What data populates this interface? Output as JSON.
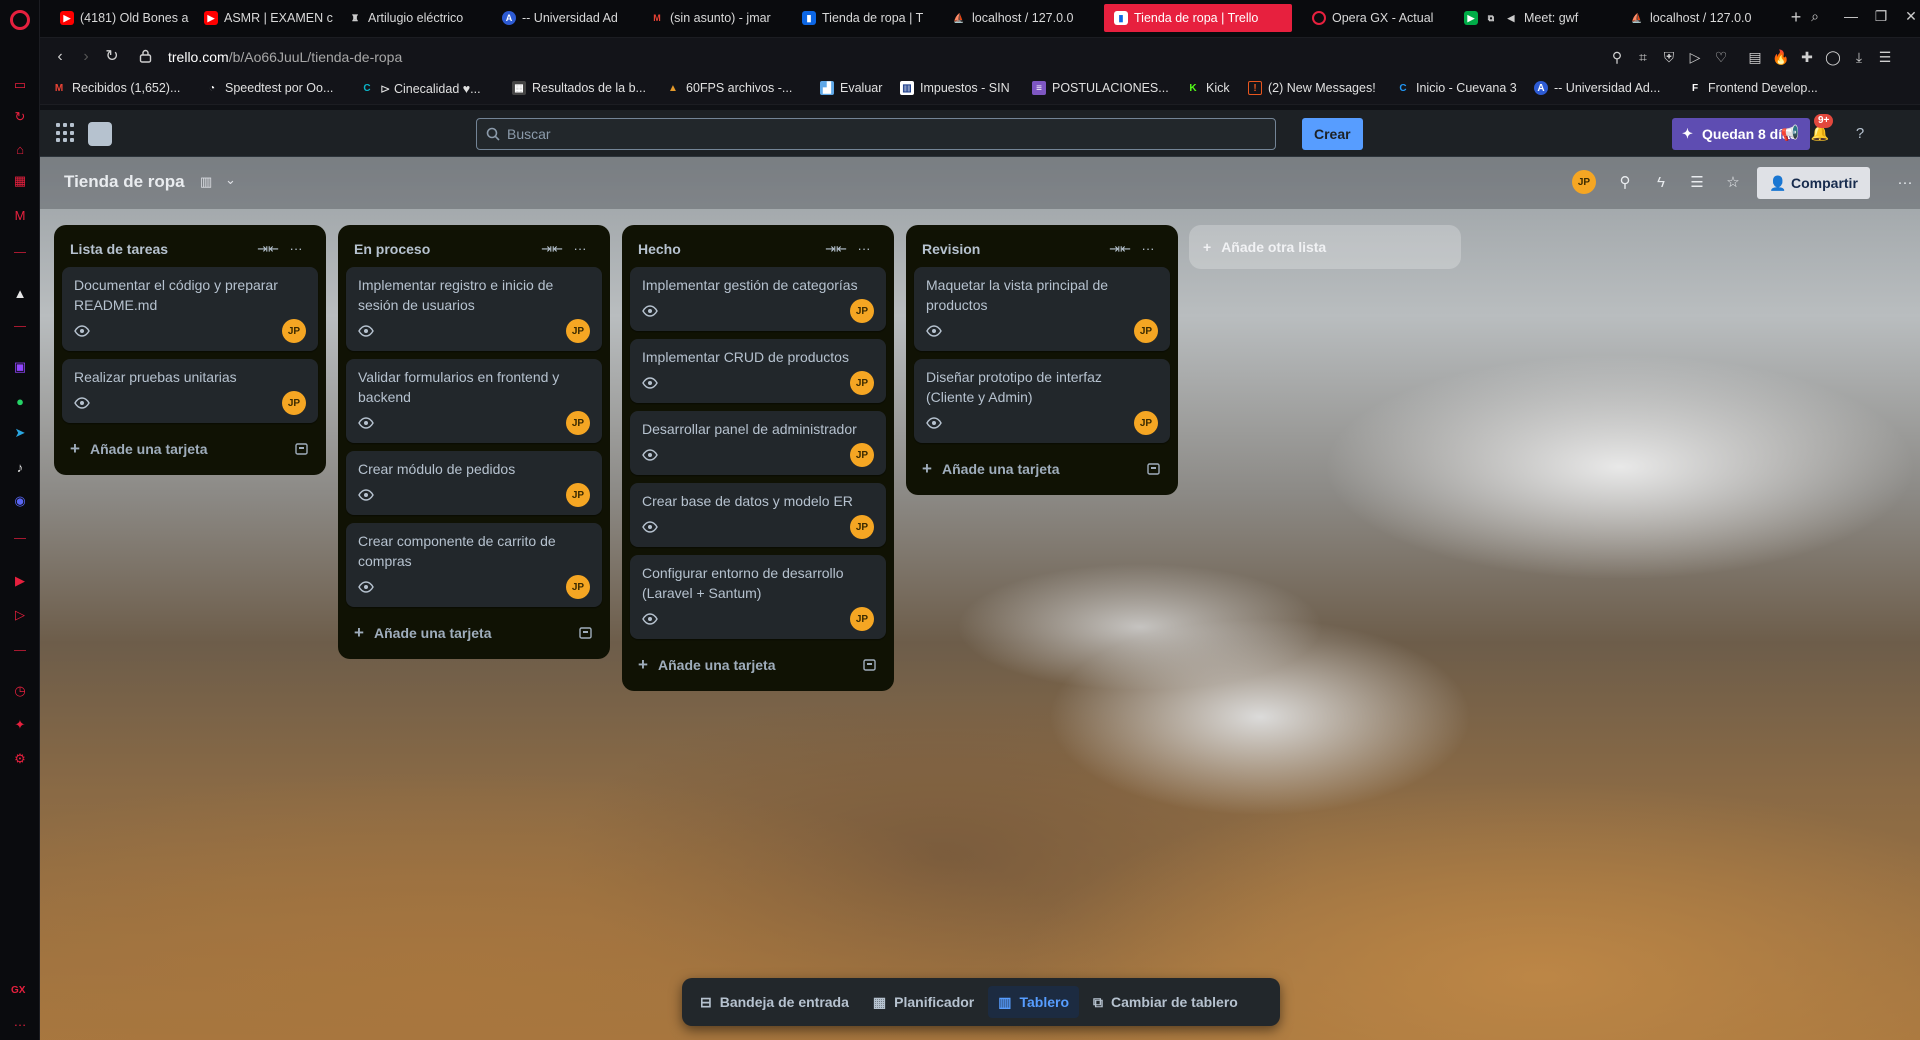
{
  "browser": {
    "tabs": [
      {
        "label": "(4181) Old Bones a",
        "icon": "youtube-icon",
        "color": "#ff0000"
      },
      {
        "label": "ASMR | EXAMEN c",
        "icon": "youtube-icon",
        "color": "#ff0000"
      },
      {
        "label": "Artilugio eléctrico",
        "icon": "page-icon",
        "color": "#cccccc"
      },
      {
        "label": "-- Universidad Ad",
        "icon": "university-icon",
        "color": "#2d5bd3"
      },
      {
        "label": "(sin asunto) - jmar",
        "icon": "gmail-icon",
        "color": "#ea4335"
      },
      {
        "label": "Tienda de ropa | T",
        "icon": "trello-icon",
        "color": "#0c66e4"
      },
      {
        "label": "localhost / 127.0.0",
        "icon": "phpmyadmin-icon",
        "color": "#f89c0e"
      },
      {
        "label": "Tienda de ropa | Trello",
        "icon": "trello-icon",
        "color": "#0c66e4"
      },
      {
        "label": "Opera GX - Actual",
        "icon": "opera-icon",
        "color": "#e7203e"
      },
      {
        "label": "Meet: gwf",
        "icon": "meet-icon",
        "color": "#00ac47"
      },
      {
        "label": "localhost / 127.0.0",
        "icon": "phpmyadmin-icon",
        "color": "#f89c0e"
      }
    ],
    "url_host": "trello.com",
    "url_path": "/b/Ao66JuuL/tienda-de-ropa",
    "bookmarks": [
      {
        "label": "Recibidos (1,652)...",
        "icon": "gmail-icon",
        "color": "#ea4335"
      },
      {
        "label": "Speedtest por Oo...",
        "icon": "speedtest-icon",
        "color": "#ffffff"
      },
      {
        "label": "⊳ Cinecalidad ♥...",
        "icon": "cinecalidad-icon",
        "color": "#0bb5c9"
      },
      {
        "label": "Resultados de la b...",
        "icon": "page-icon",
        "color": "#bbbbbb"
      },
      {
        "label": "60FPS archivos -...",
        "icon": "fps-icon",
        "color": "#e49a2b"
      },
      {
        "label": "Evaluar",
        "icon": "chart-icon",
        "color": "#5fa8e8"
      },
      {
        "label": "Impuestos - SIN",
        "icon": "sin-icon",
        "color": "#ffffff"
      },
      {
        "label": "POSTULACIONES...",
        "icon": "form-icon",
        "color": "#7e57c2"
      },
      {
        "label": "Kick",
        "icon": "kick-icon",
        "color": "#53fc18"
      },
      {
        "label": "(2) New Messages!",
        "icon": "messages-icon",
        "color": "#e8561e"
      },
      {
        "label": "Inicio - Cuevana 3",
        "icon": "cuevana-icon",
        "color": "#2196f3"
      },
      {
        "label": "-- Universidad Ad...",
        "icon": "university-icon",
        "color": "#2d5bd3"
      },
      {
        "label": "Frontend Develop...",
        "icon": "frontend-icon",
        "color": "#ffffff"
      }
    ]
  },
  "trello": {
    "search_placeholder": "Buscar",
    "create_label": "Crear",
    "trial_label": "Quedan 8 días",
    "notifications_badge": "9+",
    "user_initials": "JP",
    "board_title": "Tienda de ropa",
    "share_label": "Compartir",
    "add_list_label": "Añade otra lista",
    "add_card_label": "Añade una tarjeta",
    "lists": [
      {
        "title": "Lista de tareas",
        "cards": [
          {
            "title": "Documentar el código y preparar README.md",
            "member": "JP"
          },
          {
            "title": "Realizar pruebas unitarias",
            "member": "JP"
          }
        ]
      },
      {
        "title": "En proceso",
        "cards": [
          {
            "title": "Implementar registro e inicio de sesión de usuarios",
            "member": "JP"
          },
          {
            "title": "Validar formularios en frontend y backend",
            "member": "JP"
          },
          {
            "title": "Crear módulo de pedidos",
            "member": "JP"
          },
          {
            "title": "Crear componente de carrito de compras",
            "member": "JP"
          }
        ]
      },
      {
        "title": "Hecho",
        "cards": [
          {
            "title": "Implementar gestión de categorías",
            "member": "JP"
          },
          {
            "title": "Implementar CRUD de productos",
            "member": "JP"
          },
          {
            "title": "Desarrollar panel de administrador",
            "member": "JP"
          },
          {
            "title": "Crear base de datos y modelo ER",
            "member": "JP"
          },
          {
            "title": "Configurar entorno de desarrollo (Laravel + Santum)",
            "member": "JP"
          }
        ]
      },
      {
        "title": "Revision",
        "cards": [
          {
            "title": "Maquetar la vista principal de productos",
            "member": "JP"
          },
          {
            "title": "Diseñar prototipo de interfaz (Cliente y Admin)",
            "member": "JP"
          }
        ]
      }
    ],
    "switcher": [
      {
        "label": "Bandeja de entrada",
        "icon": "inbox-icon",
        "active": false
      },
      {
        "label": "Planificador",
        "icon": "calendar-icon",
        "active": false
      },
      {
        "label": "Tablero",
        "icon": "board-icon",
        "active": true
      },
      {
        "label": "Cambiar de tablero",
        "icon": "switch-board-icon",
        "active": false
      }
    ]
  },
  "sidebar": {
    "gx_label": "GX"
  },
  "colors": {
    "opera_red": "#e7203e",
    "trello_blue": "#579dff",
    "list_bg": "#101204",
    "card_bg": "#22272b",
    "avatar": "#f5a623",
    "trial": "#5e4db2"
  }
}
